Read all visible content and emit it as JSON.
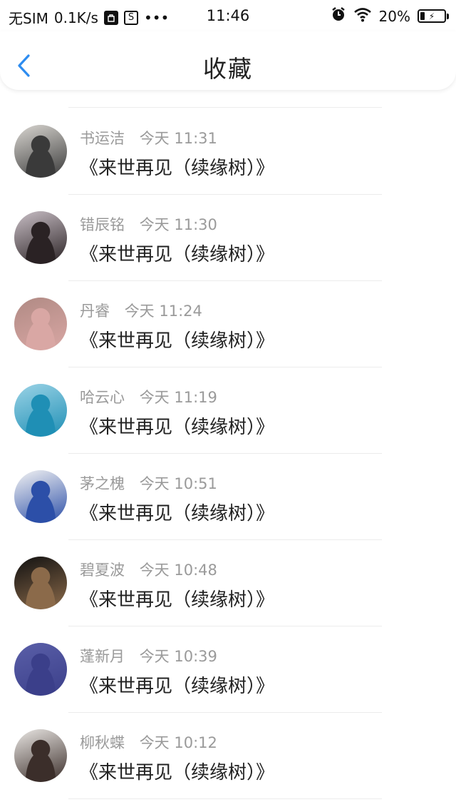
{
  "status_bar": {
    "carrier": "无SIM",
    "speed": "0.1K/s",
    "dots": "•••",
    "time": "11:46",
    "battery": "20%",
    "icons": [
      "bag-icon",
      "s-box-icon",
      "alarm-icon",
      "wifi-icon",
      "battery-icon"
    ]
  },
  "nav": {
    "back_icon": "chevron-left-icon",
    "title": "收藏",
    "accent": "#2d8cf0"
  },
  "items": [
    {
      "name": "书运洁",
      "time": "今天 11:31",
      "title": "《来世再见（续缘树）》",
      "avatar_colors": [
        "#d9d6d1",
        "#3a3a3a"
      ]
    },
    {
      "name": "错辰铭",
      "time": "今天 11:30",
      "title": "《来世再见（续缘树）》",
      "avatar_colors": [
        "#c9bfc6",
        "#2a2224"
      ]
    },
    {
      "name": "丹睿",
      "time": "今天 11:24",
      "title": "《来世再见（续缘树）》",
      "avatar_colors": [
        "#b08a84",
        "#d9a7a4"
      ]
    },
    {
      "name": "哈云心",
      "time": "今天 11:19",
      "title": "《来世再见（续缘树）》",
      "avatar_colors": [
        "#9bd3e6",
        "#1f8fb5"
      ]
    },
    {
      "name": "茅之槐",
      "time": "今天 10:51",
      "title": "《来世再见（续缘树）》",
      "avatar_colors": [
        "#f3f3f3",
        "#2c4fa8"
      ]
    },
    {
      "name": "碧夏波",
      "time": "今天 10:48",
      "title": "《来世再见（续缘树）》",
      "avatar_colors": [
        "#111111",
        "#8b6a4a"
      ]
    },
    {
      "name": "蓬新月",
      "time": "今天 10:39",
      "title": "《来世再见（续缘树）》",
      "avatar_colors": [
        "#5a5fa8",
        "#3b3f8a"
      ]
    },
    {
      "name": "柳秋蝶",
      "time": "今天 10:12",
      "title": "《来世再见（续缘树）》",
      "avatar_colors": [
        "#e9e6e3",
        "#3b2e2a"
      ]
    }
  ]
}
